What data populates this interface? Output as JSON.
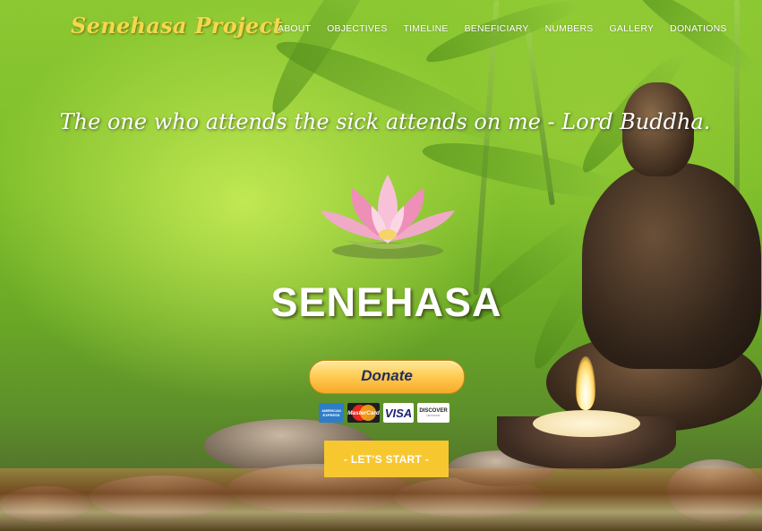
{
  "brand": {
    "logo_text": "Senehasa Project"
  },
  "nav": {
    "items": [
      "ABOUT",
      "OBJECTIVES",
      "TIMELINE",
      "BENEFICIARY",
      "NUMBERS",
      "GALLERY",
      "DONATIONS"
    ]
  },
  "hero": {
    "quote": "The one who attends the sick attends on me - Lord Buddha.",
    "title": "SENEHASA",
    "donate_label": "Donate",
    "cards": {
      "amex": "AMERICAN EXPRESS",
      "mastercard": "MasterCard",
      "visa": "VISA",
      "discover": "DISCOVER",
      "discover_sub": "NETWORK"
    },
    "start_label": "- LET'S START -"
  },
  "colors": {
    "logo": "#f5d84a",
    "start_button": "#f7c730",
    "donate_button": "#ffcc55"
  }
}
